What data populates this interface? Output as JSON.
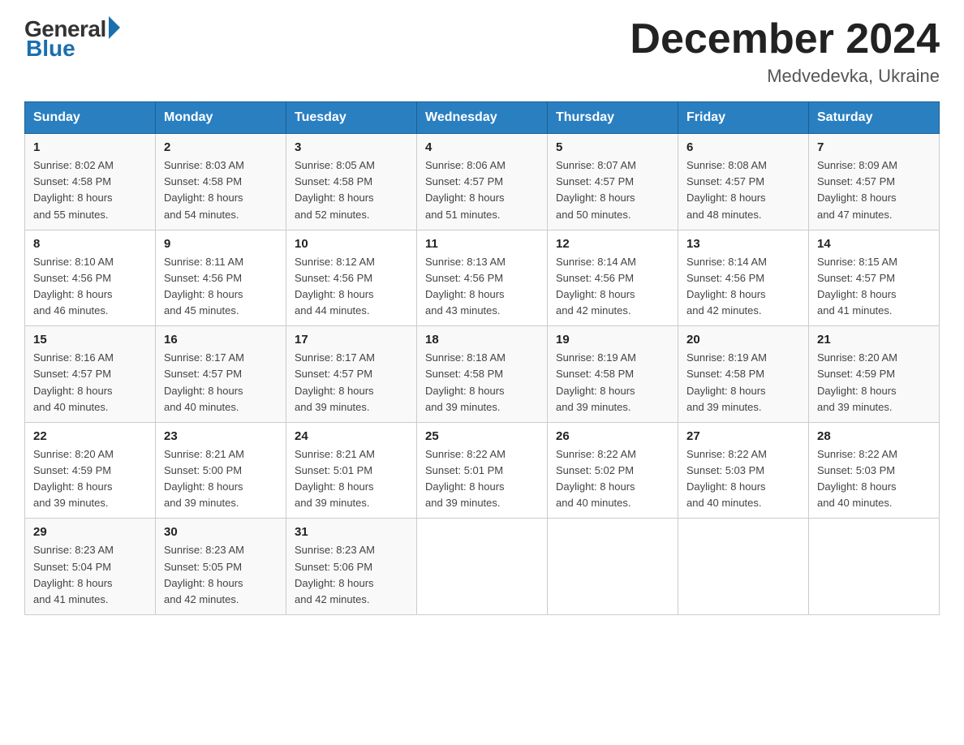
{
  "logo": {
    "general": "General",
    "blue": "Blue"
  },
  "title": "December 2024",
  "location": "Medvedevka, Ukraine",
  "days_header": [
    "Sunday",
    "Monday",
    "Tuesday",
    "Wednesday",
    "Thursday",
    "Friday",
    "Saturday"
  ],
  "weeks": [
    [
      {
        "day": "1",
        "sunrise": "8:02 AM",
        "sunset": "4:58 PM",
        "daylight": "8 hours and 55 minutes."
      },
      {
        "day": "2",
        "sunrise": "8:03 AM",
        "sunset": "4:58 PM",
        "daylight": "8 hours and 54 minutes."
      },
      {
        "day": "3",
        "sunrise": "8:05 AM",
        "sunset": "4:58 PM",
        "daylight": "8 hours and 52 minutes."
      },
      {
        "day": "4",
        "sunrise": "8:06 AM",
        "sunset": "4:57 PM",
        "daylight": "8 hours and 51 minutes."
      },
      {
        "day": "5",
        "sunrise": "8:07 AM",
        "sunset": "4:57 PM",
        "daylight": "8 hours and 50 minutes."
      },
      {
        "day": "6",
        "sunrise": "8:08 AM",
        "sunset": "4:57 PM",
        "daylight": "8 hours and 48 minutes."
      },
      {
        "day": "7",
        "sunrise": "8:09 AM",
        "sunset": "4:57 PM",
        "daylight": "8 hours and 47 minutes."
      }
    ],
    [
      {
        "day": "8",
        "sunrise": "8:10 AM",
        "sunset": "4:56 PM",
        "daylight": "8 hours and 46 minutes."
      },
      {
        "day": "9",
        "sunrise": "8:11 AM",
        "sunset": "4:56 PM",
        "daylight": "8 hours and 45 minutes."
      },
      {
        "day": "10",
        "sunrise": "8:12 AM",
        "sunset": "4:56 PM",
        "daylight": "8 hours and 44 minutes."
      },
      {
        "day": "11",
        "sunrise": "8:13 AM",
        "sunset": "4:56 PM",
        "daylight": "8 hours and 43 minutes."
      },
      {
        "day": "12",
        "sunrise": "8:14 AM",
        "sunset": "4:56 PM",
        "daylight": "8 hours and 42 minutes."
      },
      {
        "day": "13",
        "sunrise": "8:14 AM",
        "sunset": "4:56 PM",
        "daylight": "8 hours and 42 minutes."
      },
      {
        "day": "14",
        "sunrise": "8:15 AM",
        "sunset": "4:57 PM",
        "daylight": "8 hours and 41 minutes."
      }
    ],
    [
      {
        "day": "15",
        "sunrise": "8:16 AM",
        "sunset": "4:57 PM",
        "daylight": "8 hours and 40 minutes."
      },
      {
        "day": "16",
        "sunrise": "8:17 AM",
        "sunset": "4:57 PM",
        "daylight": "8 hours and 40 minutes."
      },
      {
        "day": "17",
        "sunrise": "8:17 AM",
        "sunset": "4:57 PM",
        "daylight": "8 hours and 39 minutes."
      },
      {
        "day": "18",
        "sunrise": "8:18 AM",
        "sunset": "4:58 PM",
        "daylight": "8 hours and 39 minutes."
      },
      {
        "day": "19",
        "sunrise": "8:19 AM",
        "sunset": "4:58 PM",
        "daylight": "8 hours and 39 minutes."
      },
      {
        "day": "20",
        "sunrise": "8:19 AM",
        "sunset": "4:58 PM",
        "daylight": "8 hours and 39 minutes."
      },
      {
        "day": "21",
        "sunrise": "8:20 AM",
        "sunset": "4:59 PM",
        "daylight": "8 hours and 39 minutes."
      }
    ],
    [
      {
        "day": "22",
        "sunrise": "8:20 AM",
        "sunset": "4:59 PM",
        "daylight": "8 hours and 39 minutes."
      },
      {
        "day": "23",
        "sunrise": "8:21 AM",
        "sunset": "5:00 PM",
        "daylight": "8 hours and 39 minutes."
      },
      {
        "day": "24",
        "sunrise": "8:21 AM",
        "sunset": "5:01 PM",
        "daylight": "8 hours and 39 minutes."
      },
      {
        "day": "25",
        "sunrise": "8:22 AM",
        "sunset": "5:01 PM",
        "daylight": "8 hours and 39 minutes."
      },
      {
        "day": "26",
        "sunrise": "8:22 AM",
        "sunset": "5:02 PM",
        "daylight": "8 hours and 40 minutes."
      },
      {
        "day": "27",
        "sunrise": "8:22 AM",
        "sunset": "5:03 PM",
        "daylight": "8 hours and 40 minutes."
      },
      {
        "day": "28",
        "sunrise": "8:22 AM",
        "sunset": "5:03 PM",
        "daylight": "8 hours and 40 minutes."
      }
    ],
    [
      {
        "day": "29",
        "sunrise": "8:23 AM",
        "sunset": "5:04 PM",
        "daylight": "8 hours and 41 minutes."
      },
      {
        "day": "30",
        "sunrise": "8:23 AM",
        "sunset": "5:05 PM",
        "daylight": "8 hours and 42 minutes."
      },
      {
        "day": "31",
        "sunrise": "8:23 AM",
        "sunset": "5:06 PM",
        "daylight": "8 hours and 42 minutes."
      },
      null,
      null,
      null,
      null
    ]
  ],
  "labels": {
    "sunrise": "Sunrise:",
    "sunset": "Sunset:",
    "daylight": "Daylight:"
  }
}
